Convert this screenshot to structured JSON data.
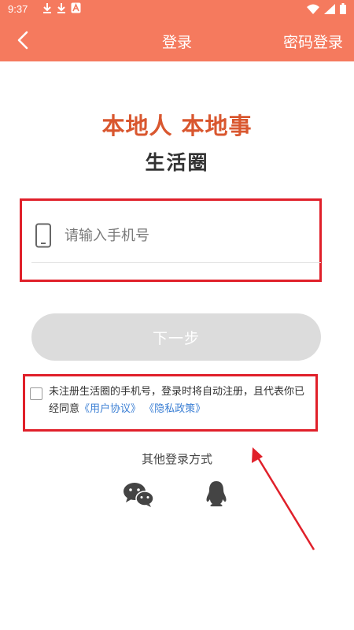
{
  "status_bar": {
    "time": "9:37",
    "left_icons": [
      "download-icon",
      "download-icon",
      "text-a-icon"
    ],
    "right_icons": [
      "wifi-icon",
      "signal-icon",
      "battery-icon"
    ]
  },
  "header": {
    "title": "登录",
    "right_action": "密码登录",
    "back_icon": "chevron-left-icon",
    "background": "#f57a5e"
  },
  "hero": {
    "slogan": "本地人 本地事",
    "subtitle": "生活圈",
    "slogan_color": "#d9572f"
  },
  "phone_input": {
    "placeholder": "请输入手机号",
    "value": "",
    "icon": "phone-icon"
  },
  "next_button": {
    "label": "下一步",
    "enabled": false
  },
  "agreement": {
    "checked": false,
    "text": "未注册生活圈的手机号，登录时将自动注册，且代表你已经同意",
    "user_agreement": "《用户协议》",
    "privacy_policy": "《隐私政策》",
    "link_color": "#3b7fd4"
  },
  "other_login": {
    "title": "其他登录方式",
    "methods": [
      "wechat-icon",
      "qq-icon"
    ]
  },
  "annotation": {
    "color": "#e0202a"
  }
}
